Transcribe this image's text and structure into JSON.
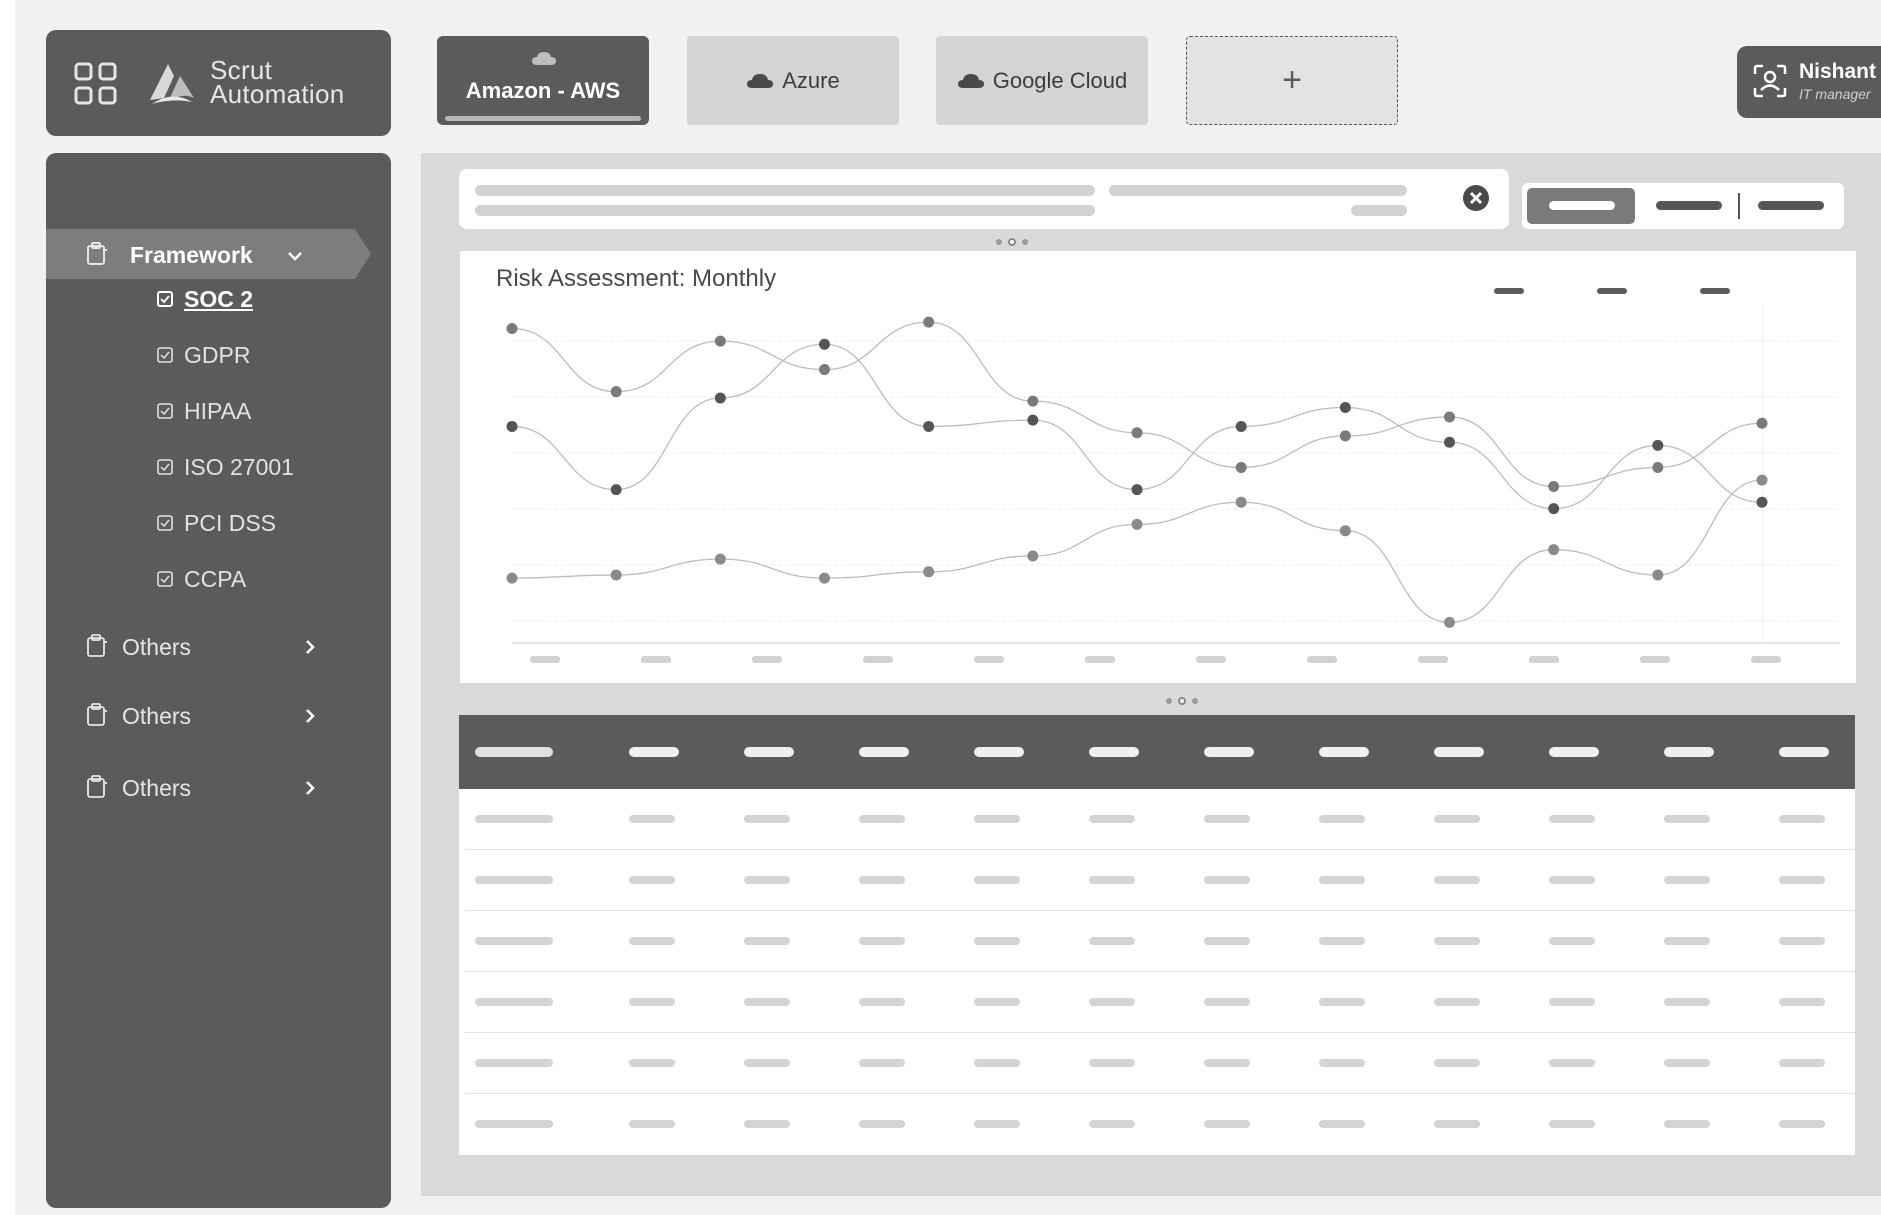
{
  "brand": {
    "line1": "Scrut",
    "line2": "Automation",
    "grid_icon": "grid-icon",
    "logo_icon": "mountain-logo-icon"
  },
  "tabs": [
    {
      "label": "Amazon - AWS",
      "icon": "cloud-icon",
      "active": true
    },
    {
      "label": "Azure",
      "icon": "cloud-icon",
      "active": false
    },
    {
      "label": "Google Cloud",
      "icon": "cloud-icon",
      "active": false
    },
    {
      "label": "+",
      "icon": "plus-icon",
      "active": false
    }
  ],
  "user": {
    "name": "Nishant",
    "role": "IT manager",
    "icon": "user-scan-icon"
  },
  "sidebar": {
    "framework": {
      "label": "Framework",
      "icon": "clipboard-icon",
      "expanded": true
    },
    "sub_items": [
      {
        "label": "SOC 2",
        "active": true
      },
      {
        "label": "GDPR",
        "active": false
      },
      {
        "label": "HIPAA",
        "active": false
      },
      {
        "label": "ISO 27001",
        "active": false
      },
      {
        "label": "PCI DSS",
        "active": false
      },
      {
        "label": "CCPA",
        "active": false
      }
    ],
    "others": [
      {
        "label": "Others"
      },
      {
        "label": "Others"
      },
      {
        "label": "Others"
      }
    ]
  },
  "colors": {
    "panel_dark": "#5b5b5b",
    "panel_mid": "#7d7d7d",
    "tab_grey": "#d4d4d4",
    "canvas": "#f1f1f1",
    "main_bg": "#d9d9d9",
    "series_dark": "#555555",
    "series_mid": "#7a7a7a",
    "series_light": "#8a8a8a"
  },
  "chart_data": {
    "type": "line",
    "title": "Risk Assessment: Monthly",
    "xlabel": "",
    "ylabel": "",
    "ylim": [
      0,
      1
    ],
    "grid": true,
    "legend_position": "top-right",
    "x_count": 13,
    "series": [
      {
        "values": [
          0.97,
          0.77,
          0.93,
          0.84,
          0.99,
          0.74,
          0.64,
          0.53,
          0.63,
          0.69,
          0.47,
          0.53,
          0.67
        ]
      },
      {
        "values": [
          0.66,
          0.46,
          0.75,
          0.92,
          0.66,
          0.68,
          0.46,
          0.66,
          0.72,
          0.61,
          0.4,
          0.6,
          0.42
        ]
      },
      {
        "values": [
          0.18,
          0.19,
          0.24,
          0.18,
          0.2,
          0.25,
          0.35,
          0.42,
          0.33,
          0.04,
          0.27,
          0.19,
          0.49
        ]
      }
    ]
  },
  "table": {
    "columns": 12,
    "rows": 6
  }
}
